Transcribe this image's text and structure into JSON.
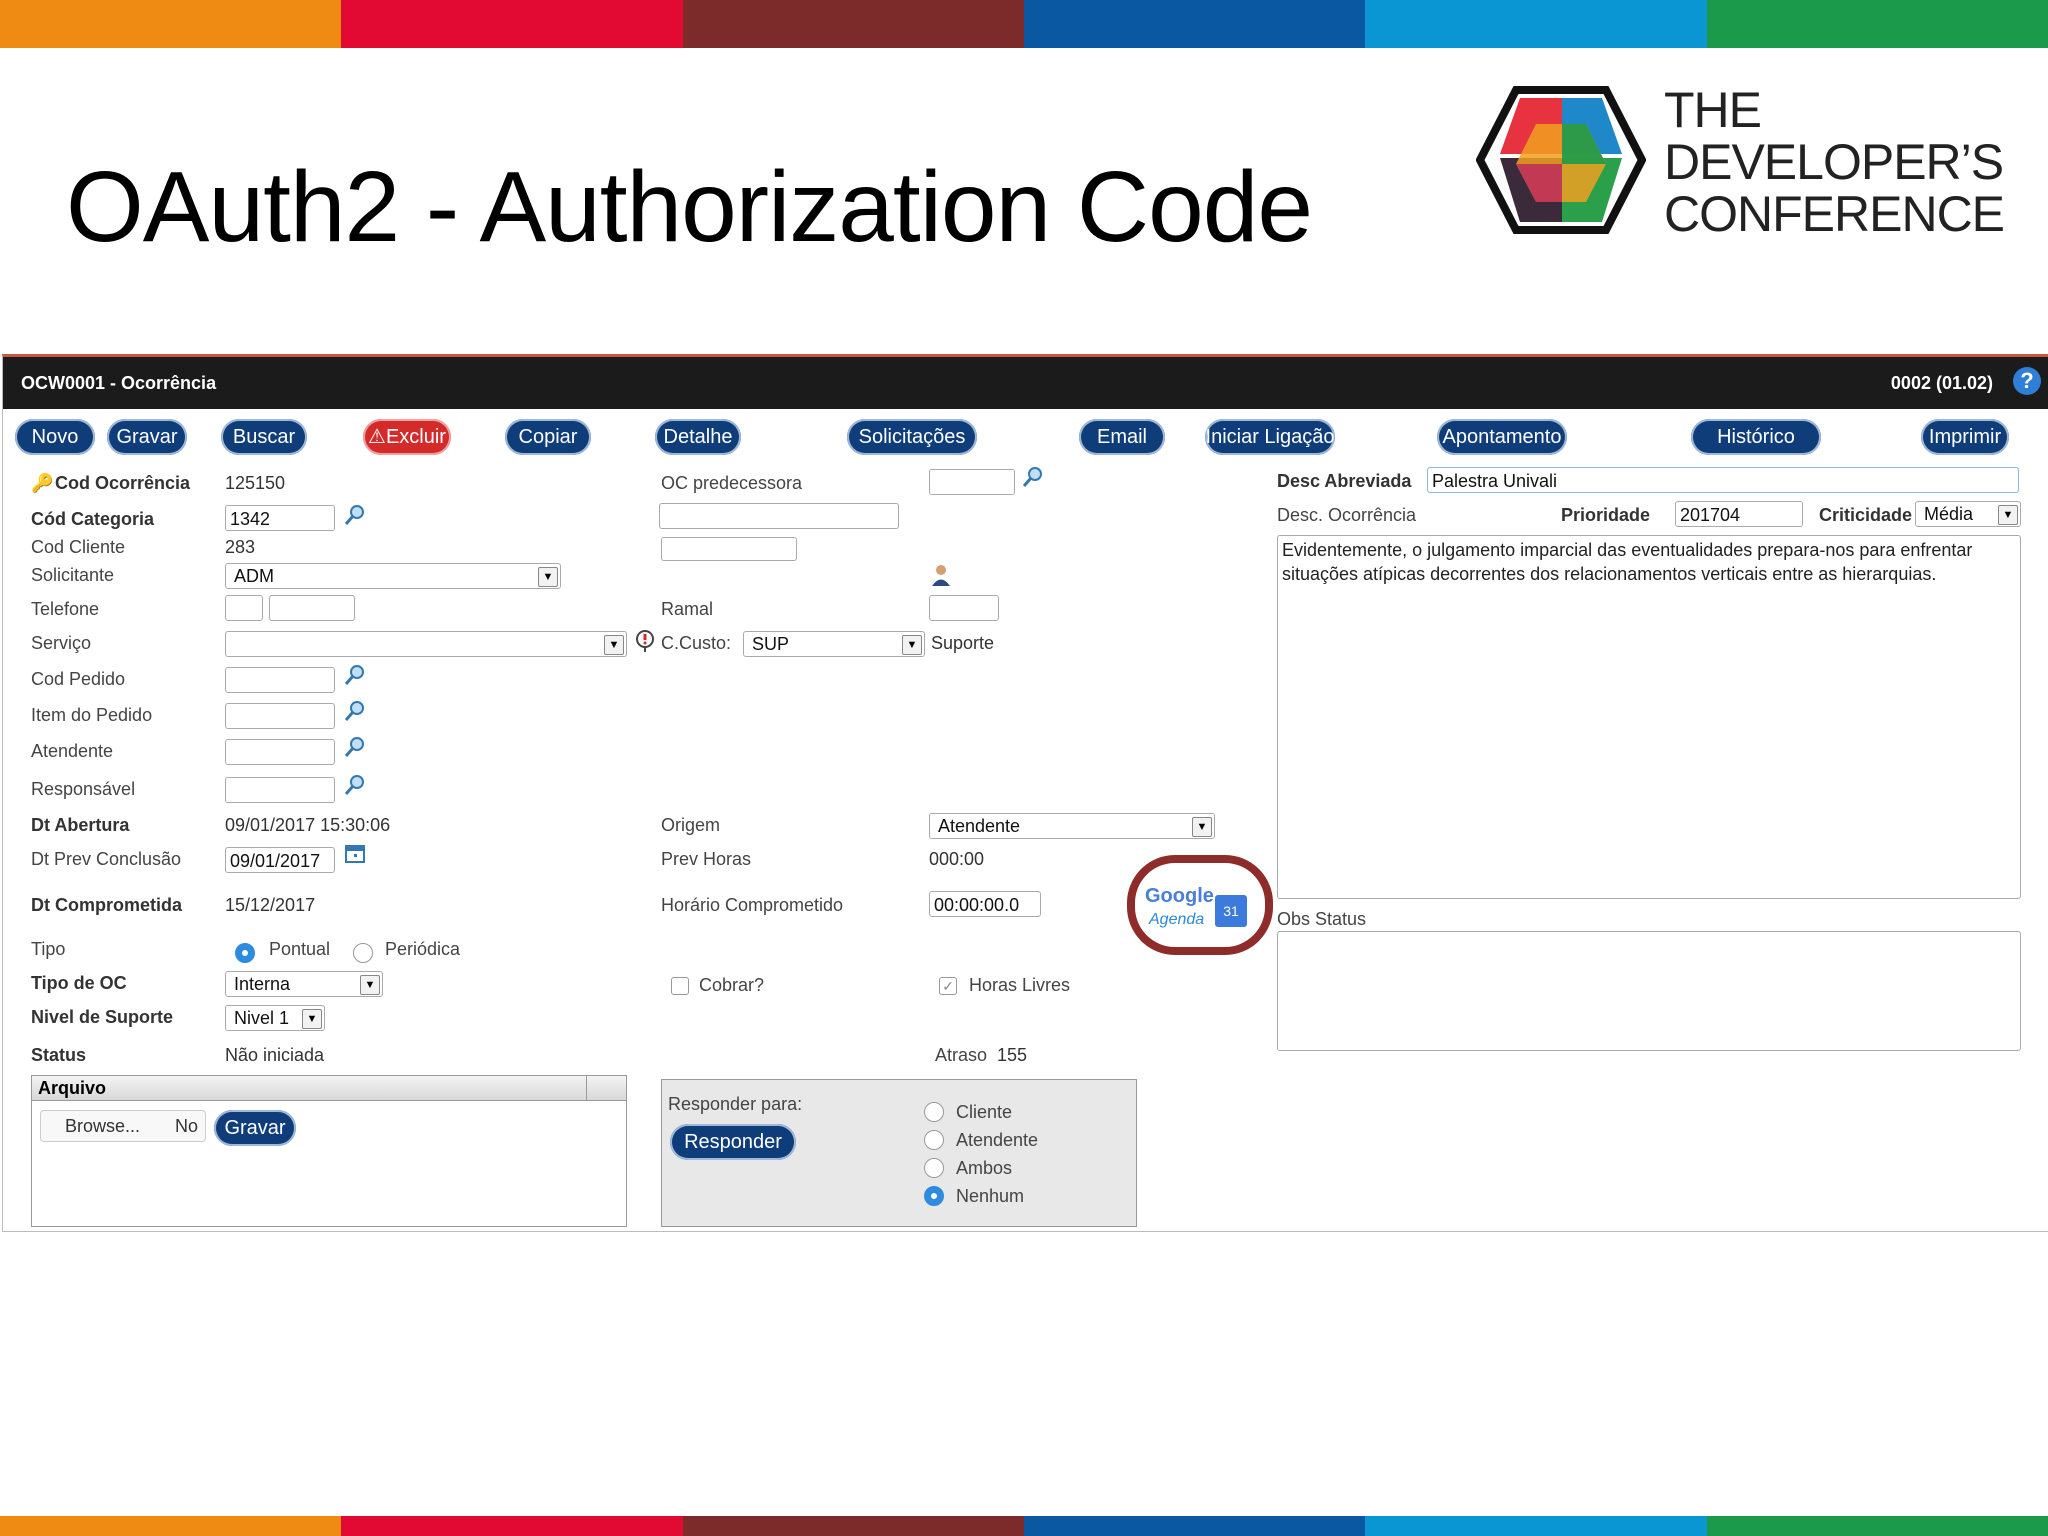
{
  "colors": {
    "stripes": [
      "#ef8a13",
      "#e20a32",
      "#7d2a2b",
      "#0a58a2",
      "#0a95d3",
      "#1a9a4a"
    ],
    "title_bar": "#1b1b1b",
    "button": "#0e3d7a",
    "danger": "#d42a2a",
    "highlight_ring": "#8e2b2b"
  },
  "slide": {
    "title": "OAuth2 - Authorization Code",
    "logo": {
      "line1": "THE",
      "line2": "DEVELOPER’S",
      "line3": "CONFERENCE",
      "icon": "cube-logo-icon"
    }
  },
  "window": {
    "title": "OCW0001 - Ocorrência",
    "version": "0002 (01.02)",
    "help": "?"
  },
  "toolbar": {
    "novo": "Novo",
    "gravar": "Gravar",
    "buscar": "Buscar",
    "excluir": "Excluir",
    "copiar": "Copiar",
    "detalhe": "Detalhe",
    "solicitacoes": "Solicitações",
    "email": "Email",
    "iniciar_ligacao": "Iniciar Ligação",
    "apontamento": "Apontamento",
    "historico": "Histórico",
    "imprimir": "Imprimir"
  },
  "left": {
    "cod_ocorrencia_label": "Cod Ocorrência",
    "cod_ocorrencia": "125150",
    "cod_categoria_label": "Cód Categoria",
    "cod_categoria": "1342",
    "cod_cliente_label": "Cod Cliente",
    "cod_cliente": "283",
    "solicitante_label": "Solicitante",
    "solicitante": "ADM",
    "telefone_label": "Telefone",
    "servico_label": "Serviço",
    "cod_pedido_label": "Cod Pedido",
    "item_pedido_label": "Item do Pedido",
    "atendente_label": "Atendente",
    "responsavel_label": "Responsável",
    "dt_abertura_label": "Dt Abertura",
    "dt_abertura": "09/01/2017 15:30:06",
    "dt_prev_label": "Dt Prev Conclusão",
    "dt_prev": "09/01/2017",
    "dt_comprometida_label": "Dt Comprometida",
    "dt_comprometida": "15/12/2017",
    "tipo_label": "Tipo",
    "tipo_pontual": "Pontual",
    "tipo_periodica": "Periódica",
    "tipo_oc_label": "Tipo de OC",
    "tipo_oc": "Interna",
    "nivel_label": "Nivel de Suporte",
    "nivel": "Nivel 1",
    "status_label": "Status",
    "status": "Não iniciada"
  },
  "middle": {
    "oc_pred_label": "OC predecessora",
    "ramal_label": "Ramal",
    "ccusto_label": "C.Custo:",
    "ccusto": "SUP",
    "ccusto_desc": "Suporte",
    "origem_label": "Origem",
    "origem": "Atendente",
    "prev_horas_label": "Prev Horas",
    "prev_horas": "000:00",
    "horario_label": "Horário Comprometido",
    "horario": "00:00:00.0",
    "cobrar_label": "Cobrar?",
    "horas_livres_label": "Horas Livres",
    "atraso_label": "Atraso",
    "atraso": "155"
  },
  "google_agenda": {
    "brand": "Google",
    "product": "Agenda",
    "day": "31"
  },
  "right": {
    "desc_abrev_label": "Desc Abreviada",
    "desc_abrev": "Palestra Univali",
    "desc_oc_label": "Desc. Ocorrência",
    "prioridade_label": "Prioridade",
    "prioridade": "201704",
    "criticidade_label": "Criticidade",
    "criticidade": "Média",
    "descricao": "Evidentemente, o julgamento imparcial das eventualidades prepara-nos para enfrentar situações atípicas decorrentes dos relacionamentos verticais entre as hierarquias.",
    "obs_status_label": "Obs Status"
  },
  "arquivo": {
    "title": "Arquivo",
    "browse": "Browse...",
    "no_file": "No",
    "gravar": "Gravar"
  },
  "responder": {
    "label": "Responder para:",
    "button": "Responder",
    "opt_cliente": "Cliente",
    "opt_atendente": "Atendente",
    "opt_ambos": "Ambos",
    "opt_nenhum": "Nenhum"
  }
}
